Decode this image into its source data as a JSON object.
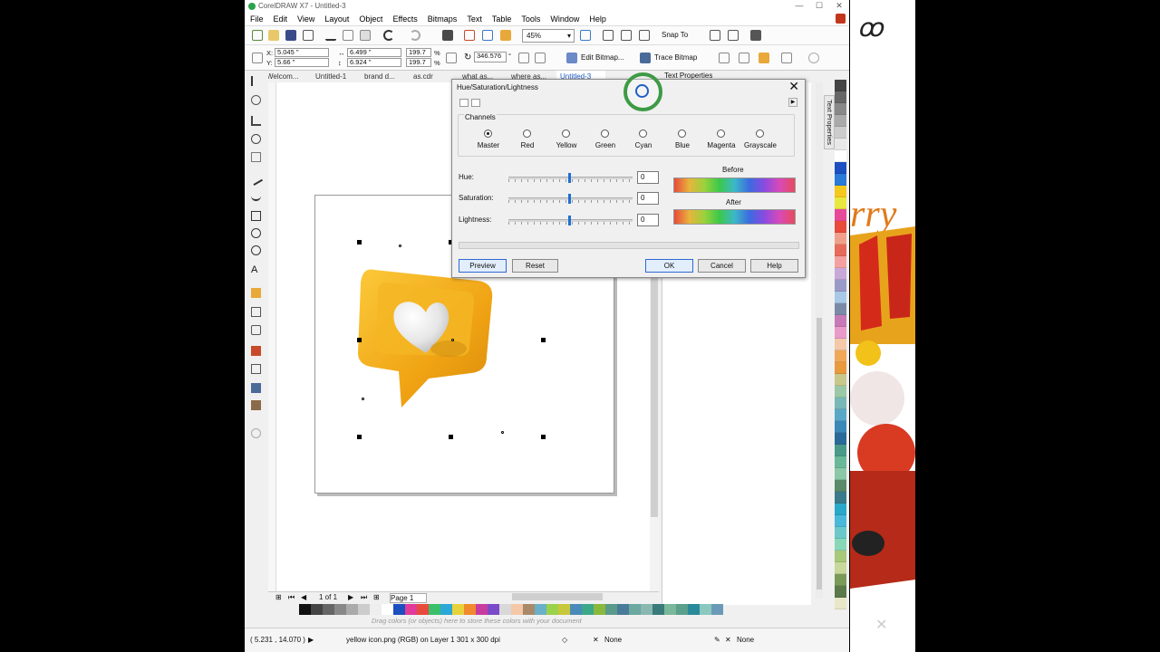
{
  "window": {
    "title": "CorelDRAW X7 - Untitled-3",
    "minimize": "—",
    "maximize": "☐",
    "close": "✕"
  },
  "menu": [
    "File",
    "Edit",
    "View",
    "Layout",
    "Object",
    "Effects",
    "Bitmaps",
    "Text",
    "Table",
    "Tools",
    "Window",
    "Help"
  ],
  "toolbar": {
    "zoom": "45%",
    "snap_to": "Snap To",
    "x": "5.045 \"",
    "y": "5.66 \"",
    "w": "6.499 \"",
    "h": "6.924 \"",
    "scale_w": "199.7",
    "scale_h": "199.7",
    "scale_unit": "%",
    "angle": "346.576",
    "angle_unit": "°",
    "edit_bitmap": "Edit Bitmap...",
    "trace_bitmap": "Trace Bitmap"
  },
  "doc_tabs": [
    "Welcom...",
    "Untitled-1",
    "brand d...",
    "as.cdr",
    "what as...",
    "where as...",
    "Untitled-3"
  ],
  "active_tab": "Untitled-3",
  "docker": {
    "title": "Text Properties",
    "vertical_tab": "Text Properties"
  },
  "dialog": {
    "title": "Hue/Saturation/Lightness",
    "close": "✕",
    "channels_label": "Channels",
    "channels": [
      "Master",
      "Red",
      "Yellow",
      "Green",
      "Cyan",
      "Blue",
      "Magenta",
      "Grayscale"
    ],
    "selected_channel": "Master",
    "sliders": [
      {
        "label": "Hue:",
        "value": "0",
        "position": 0.5
      },
      {
        "label": "Saturation:",
        "value": "0",
        "position": 0.5
      },
      {
        "label": "Lightness:",
        "value": "0",
        "position": 0.5
      }
    ],
    "before_label": "Before",
    "after_label": "After",
    "buttons": {
      "preview": "Preview",
      "reset": "Reset",
      "ok": "OK",
      "cancel": "Cancel",
      "help": "Help"
    }
  },
  "page_nav": {
    "page_count": "1 of 1",
    "page_tab": "Page 1"
  },
  "palette_hint": "Drag colors (or objects) here to store these colors with your document",
  "status": {
    "coords": "( 5.231 , 14.070 )",
    "object_info": "yellow icon.png (RGB) on Layer 1 301 x 300 dpi",
    "fill": "None",
    "outline": "None"
  },
  "colors": {
    "accent_blue": "#1e5ac8",
    "highlight_ring": "#3e9a45",
    "icon_orange": "#f4b01c"
  },
  "hpalette": [
    "#111111",
    "#444444",
    "#666666",
    "#888888",
    "#aaaaaa",
    "#cccccc",
    "#eeeeee",
    "#ffffff",
    "#1c4fbf",
    "#e03a9a",
    "#e84a3c",
    "#3ac06a",
    "#2aa8d8",
    "#e8d23c",
    "#f08a2c",
    "#c83ca0",
    "#7a4ac8",
    "#d8d8d8",
    "#f4c8a8",
    "#a88a6a",
    "#6ab0c8",
    "#9ad24a",
    "#c8c83c",
    "#4a8ab8",
    "#3ca88a",
    "#8ab83c",
    "#5a9a8a",
    "#4a7a9a",
    "#6aa8a0",
    "#88b8b0",
    "#3a7a7a",
    "#7ab89a",
    "#5aa08a",
    "#2a8a9a",
    "#8ac8c0",
    "#6a9ab8"
  ],
  "vpalette": [
    "#444444",
    "#666666",
    "#888888",
    "#aaaaaa",
    "#cccccc",
    "#e8e8e8",
    "#ffffff",
    "#1c4fbf",
    "#2a7ad8",
    "#f4c81c",
    "#e8e83c",
    "#e84a9a",
    "#e84a3c",
    "#f0a08a",
    "#e86a5a",
    "#f4a0a0",
    "#c8a8d8",
    "#9a9ac8",
    "#a8c8e8",
    "#7a8aa8",
    "#c87ab8",
    "#e89ac8",
    "#f4c8a8",
    "#f0a858",
    "#e89a3c",
    "#c8c88a",
    "#9ac8a8",
    "#7ab8b8",
    "#5aa8c8",
    "#3a88b8",
    "#2a6a98",
    "#4a9a8a",
    "#6ab89a",
    "#8ac8a8",
    "#5a8a6a",
    "#3a7a8a",
    "#2aa8c8",
    "#4ab8d8",
    "#6ac8c8",
    "#88d8b8",
    "#a8c87a",
    "#c8d89a",
    "#7a9a5a",
    "#5a7a4a",
    "#e8e8c8"
  ]
}
